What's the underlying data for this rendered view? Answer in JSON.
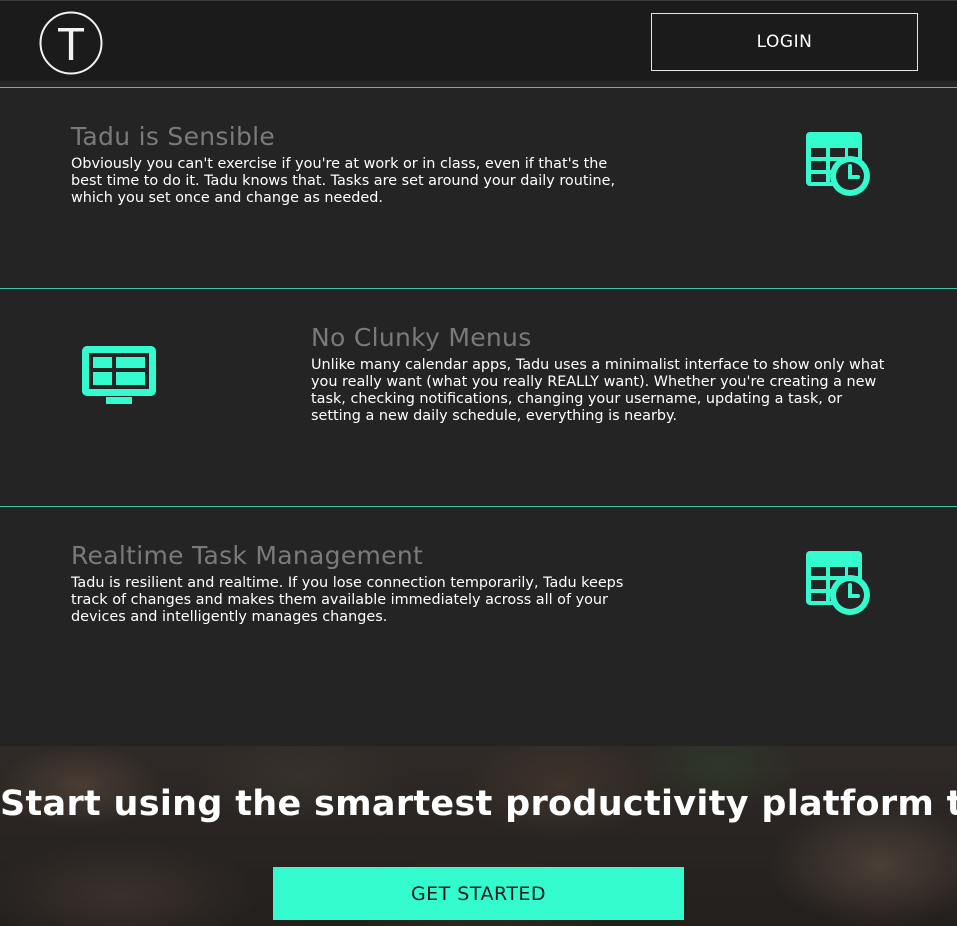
{
  "header": {
    "logo_letter": "T",
    "login_label": "LOGIN"
  },
  "features": [
    {
      "title": "Tadu is Sensible",
      "text": "Obviously you can't exercise if you're at work or in class, even if that's the best time to do it. Tadu knows that. Tasks are set around your daily routine, which you set once and change as needed.",
      "icon": "calendar-clock-icon"
    },
    {
      "title": "No Clunky Menus",
      "text": "Unlike many calendar apps, Tadu uses a minimalist interface to show only what you really want (what you really REALLY want). Whether you're creating a new task, checking notifications, changing your username, updating a task, or setting a new daily schedule, everything is nearby.",
      "icon": "monitor-dashboard-icon"
    },
    {
      "title": "Realtime Task Management",
      "text": "Tadu is resilient and realtime. If you lose connection temporarily, Tadu keeps track of changes and makes them available immediately across all of your devices and intelligently manages changes.",
      "icon": "calendar-clock-icon"
    }
  ],
  "hero": {
    "title": "Start using the smartest productivity platform today.",
    "cta_label": "GET STARTED"
  },
  "colors": {
    "accent": "#33fbcd",
    "background": "#242424",
    "header_bg": "#1b1b1b",
    "divider": "#3fc7a4"
  }
}
